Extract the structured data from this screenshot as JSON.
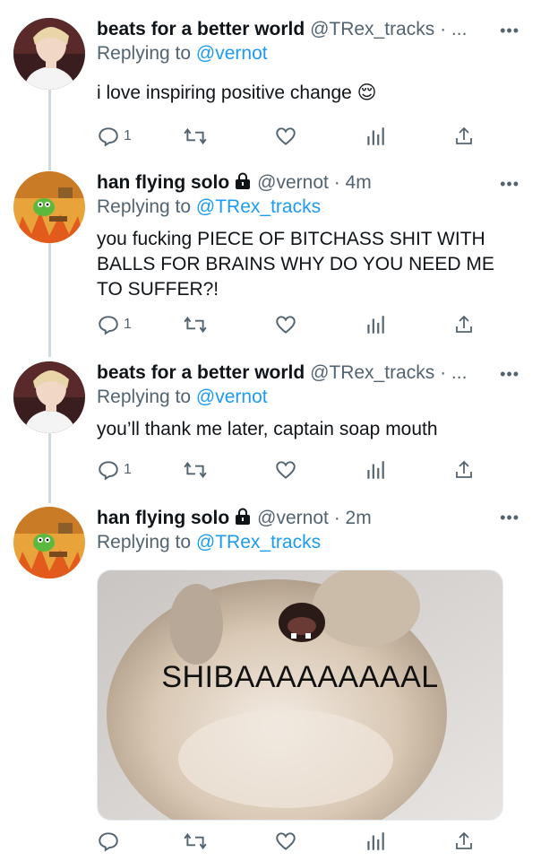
{
  "tweets": [
    {
      "name": "beats for a better world",
      "handle": "@TRex_tracks",
      "sep": " · ",
      "time": "...",
      "replying_prefix": "Replying to ",
      "replying_to": "@vernot",
      "text": "i love inspiring positive change 😌",
      "reply_count": "1"
    },
    {
      "name": "han flying solo",
      "handle": "@vernot",
      "sep": " · ",
      "time": "4m",
      "replying_prefix": "Replying to ",
      "replying_to": "@TRex_tracks",
      "text": "you fucking PIECE OF BITCHASS SHIT WITH BALLS FOR BRAINS WHY DO YOU NEED ME TO SUFFER?!",
      "reply_count": "1"
    },
    {
      "name": "beats for a better world",
      "handle": "@TRex_tracks",
      "sep": " · ",
      "time": "...",
      "replying_prefix": "Replying to ",
      "replying_to": "@vernot",
      "text": "you’ll thank me later, captain soap mouth",
      "reply_count": "1"
    },
    {
      "name": "han flying solo",
      "handle": "@vernot",
      "sep": " · ",
      "time": "2m",
      "replying_prefix": "Replying to ",
      "replying_to": "@TRex_tracks",
      "media_caption": "SHIBAAAAAAAAAL",
      "reply_count": ""
    }
  ],
  "more_icon": "•••",
  "icons": [
    "reply-icon",
    "retweet-icon",
    "like-icon",
    "analytics-icon",
    "share-icon",
    "lock-icon",
    "more-icon"
  ],
  "colors": {
    "link": "#1d9bf0",
    "muted": "#536471",
    "text": "#0f1419",
    "thread": "#cfd9de"
  }
}
